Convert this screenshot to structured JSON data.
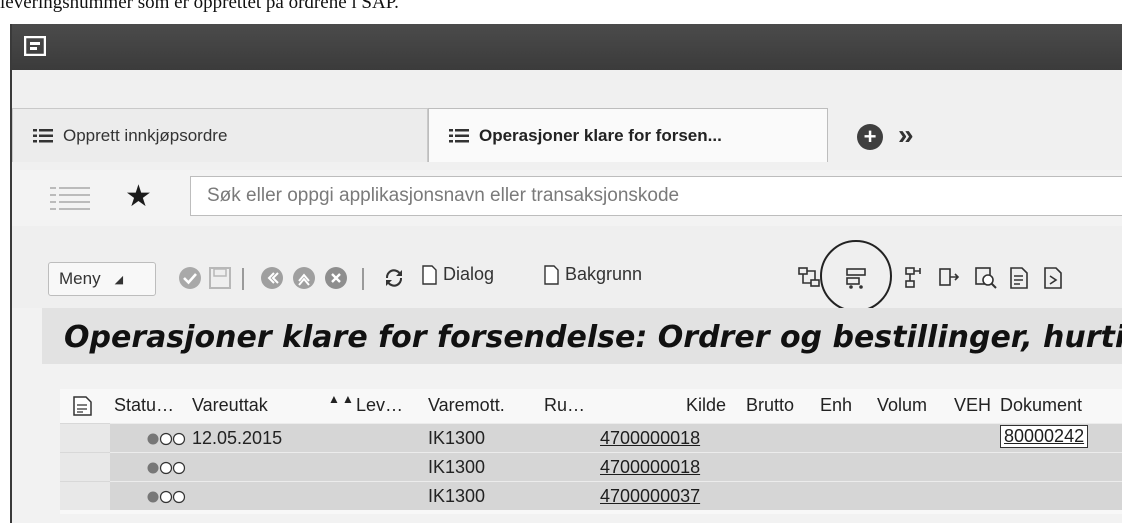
{
  "document_caption": "leveringsnummer som er opprettet på ordrene i SAP.",
  "tabs": [
    {
      "label": "Opprett innkjøpsordre",
      "active": false
    },
    {
      "label": "Operasjoner klare for forsen...",
      "active": true
    }
  ],
  "search": {
    "placeholder": "Søk eller oppgi applikasjonsnavn eller transaksjonskode"
  },
  "toolbar": {
    "menu_label": "Meny",
    "dialog_label": "Dialog",
    "background_label": "Bakgrunn"
  },
  "page_title": "Operasjoner klare for forsendelse: Ordrer og bestillinger, hurtigvi",
  "table": {
    "columns": [
      "Statu…",
      "Vareuttak",
      "Lev…",
      "Varemott.",
      "Ru…",
      "Kilde",
      "Brutto",
      "Enh",
      "Volum",
      "VEH",
      "Dokument"
    ],
    "rows": [
      {
        "vareuttak": "12.05.2015",
        "varemott": "IK1300",
        "kilde": "4700000018",
        "dokument": "80000242"
      },
      {
        "vareuttak": "",
        "varemott": "IK1300",
        "kilde": "4700000018",
        "dokument": ""
      },
      {
        "vareuttak": "",
        "varemott": "IK1300",
        "kilde": "4700000037",
        "dokument": ""
      }
    ]
  },
  "colors": {
    "shell_bar": "#3f3f3f",
    "title_band": "#e2e2e2",
    "row_background": "#d6d6d6",
    "annotation": "#222222"
  },
  "icons": [
    "sap-shell-icon",
    "list-icon",
    "add-tab-icon",
    "more-tabs-icon",
    "star-icon",
    "confirm-icon",
    "save-icon",
    "back-icon",
    "exit-icon",
    "cancel-icon",
    "refresh-icon",
    "document-icon",
    "split-icon",
    "create-delivery-icon",
    "hierarchy-icon",
    "transfer-icon",
    "search-details-icon",
    "display-icon",
    "output-icon"
  ]
}
